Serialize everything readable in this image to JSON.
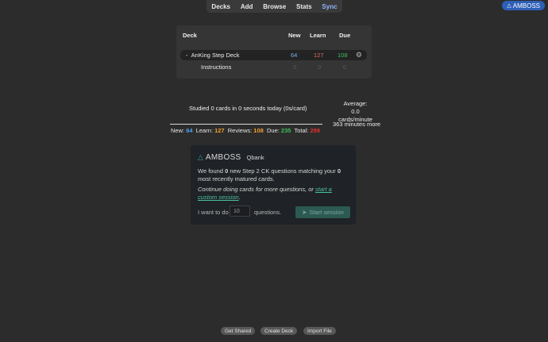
{
  "nav": {
    "decks": "Decks",
    "add": "Add",
    "browse": "Browse",
    "stats": "Stats",
    "sync": "Sync"
  },
  "amboss_badge": {
    "icon": "amboss-triangle-icon",
    "label": "AMBOSS"
  },
  "deck_table": {
    "headers": {
      "deck": "Deck",
      "new": "New",
      "learn": "Learn",
      "due": "Due"
    },
    "rows": [
      {
        "toggle": "-",
        "name": "AnKing Step Deck",
        "new": "64",
        "learn": "127",
        "due": "108"
      },
      {
        "name": "Instructions",
        "new": "0",
        "learn": "0",
        "due": "0"
      }
    ]
  },
  "stats": {
    "studied": "Studied 0 cards in 0 seconds today (0s/card)",
    "avg_label": "Average:",
    "avg_value": "0.0 cards/minute",
    "more": "363 minutes more",
    "new_label": "New:",
    "new_val": "64",
    "learn_label": "Learn:",
    "learn_val": "127",
    "reviews_label": "Reviews:",
    "reviews_val": "108",
    "due_label": "Due:",
    "due_val": "235",
    "total_label": "Total:",
    "total_val": "299"
  },
  "amboss_card": {
    "brand": "AMBOSS",
    "product": "Qbank",
    "msg_a": "We found ",
    "msg_b": "0",
    "msg_c": " new Step 2 CK questions matching your ",
    "msg_d": "0",
    "msg_e": " most recently matured cards.",
    "cont": "Continue doing cards for more questions, or ",
    "link": "start a custom session",
    "cont_end": ".",
    "want": "I want to do",
    "input_value": "10",
    "questions": "questions.",
    "start": "Start session",
    "start_icon": "rocket-icon"
  },
  "footer": {
    "get_shared": "Get Shared",
    "create_deck": "Create Deck",
    "import_file": "Import File"
  },
  "colors": {
    "new": "#6fb1f0",
    "learn": "#e56767",
    "due": "#3fbf55",
    "stat_new": "#4aa3f0",
    "stat_learn": "#f0a030",
    "stat_reviews": "#f0a030",
    "stat_due": "#3fbf55",
    "stat_total": "#e53030"
  }
}
